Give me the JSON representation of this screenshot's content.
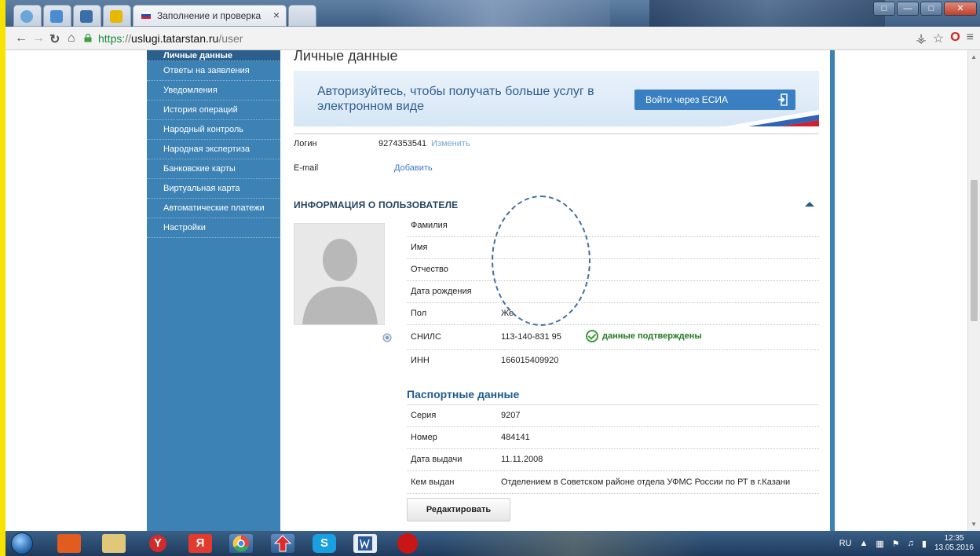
{
  "browser": {
    "tab_title": "Заполнение и проверка",
    "tab_close": "×",
    "url_scheme": "https",
    "url_rest": "://",
    "url_host": "uslugi.tatarstan.ru",
    "url_path": "/user"
  },
  "sidebar": {
    "items": [
      {
        "label": "Личные данные"
      },
      {
        "label": "Ответы на заявления"
      },
      {
        "label": "Уведомления"
      },
      {
        "label": "История операций"
      },
      {
        "label": "Народный контроль"
      },
      {
        "label": "Народная экспертиза"
      },
      {
        "label": "Банковские карты"
      },
      {
        "label": "Виртуальная карта"
      },
      {
        "label": "Автоматические платежи"
      },
      {
        "label": "Настройки"
      }
    ]
  },
  "main": {
    "title": "Личные данные",
    "banner": {
      "text": "Авторизуйтесь, чтобы получать больше услуг в электронном виде",
      "button_label": "Войти через ЕСИА"
    },
    "login": {
      "label": "Логин",
      "value": "9274353541",
      "change_link": "Изменить"
    },
    "email": {
      "label": "E-mail",
      "add_link": "Добавить"
    },
    "user_info_title": "ИНФОРМАЦИЯ О ПОЛЬЗОВАТЕЛЕ",
    "fields": {
      "last_name": {
        "label": "Фамилия",
        "value": ""
      },
      "first_name": {
        "label": "Имя",
        "value": ""
      },
      "patronymic": {
        "label": "Отчество",
        "value": ""
      },
      "birth_date": {
        "label": "Дата рождения",
        "value": ""
      },
      "gender": {
        "label": "Пол",
        "value": "Же"
      },
      "snils": {
        "label": "СНИЛС",
        "value": "113-140-831 95",
        "status": "данные подтверждены"
      },
      "inn": {
        "label": "ИНН",
        "value": "166015409920"
      }
    },
    "passport": {
      "title": "Паспортные данные",
      "series": {
        "label": "Серия",
        "value": "9207"
      },
      "number": {
        "label": "Номер",
        "value": "484141"
      },
      "issue_date": {
        "label": "Дата выдачи",
        "value": "11.11.2008"
      },
      "issued_by": {
        "label": "Кем выдан",
        "value": "Отделением в Советском районе отдела УФМС России по РТ в г.Казани"
      }
    },
    "edit_button": "Редактировать"
  },
  "taskbar": {
    "language": "RU",
    "time": "12:35",
    "date": "13.05.2016",
    "apps": [
      {
        "icon": "yandex-browser-icon",
        "glyph": "Y"
      },
      {
        "icon": "yandex-icon",
        "glyph": "Я"
      },
      {
        "icon": "skype-icon",
        "glyph": "S"
      }
    ]
  }
}
